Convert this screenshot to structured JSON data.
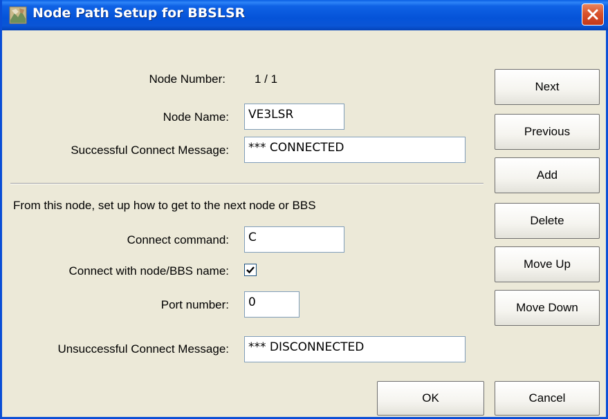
{
  "window": {
    "title": "Node Path Setup for BBSLSR"
  },
  "form": {
    "node_number_label": "Node Number:",
    "node_number_value": "1 / 1",
    "node_name_label": "Node Name:",
    "node_name_value": "VE3LSR",
    "success_msg_label": "Successful Connect Message:",
    "success_msg_value": "*** CONNECTED",
    "instructions": "From this node, set up how to get to the next node or BBS",
    "connect_cmd_label": "Connect command:",
    "connect_cmd_value": "C",
    "connect_with_name_label": "Connect with node/BBS name:",
    "connect_with_name_checked": true,
    "port_label": "Port number:",
    "port_value": "0",
    "unsuccess_msg_label": "Unsuccessful Connect Message:",
    "unsuccess_msg_value": "*** DISCONNECTED"
  },
  "buttons": {
    "next": "Next",
    "previous": "Previous",
    "add": "Add",
    "delete": "Delete",
    "move_up": "Move Up",
    "move_down": "Move Down",
    "ok": "OK",
    "cancel": "Cancel"
  },
  "icons": {
    "app": "node-path-app-icon",
    "close": "close-icon",
    "check": "checkmark-icon"
  },
  "colors": {
    "titlebar": "#0553D8",
    "dialog_bg": "#ECE9D8",
    "close_button": "#D9532B"
  }
}
